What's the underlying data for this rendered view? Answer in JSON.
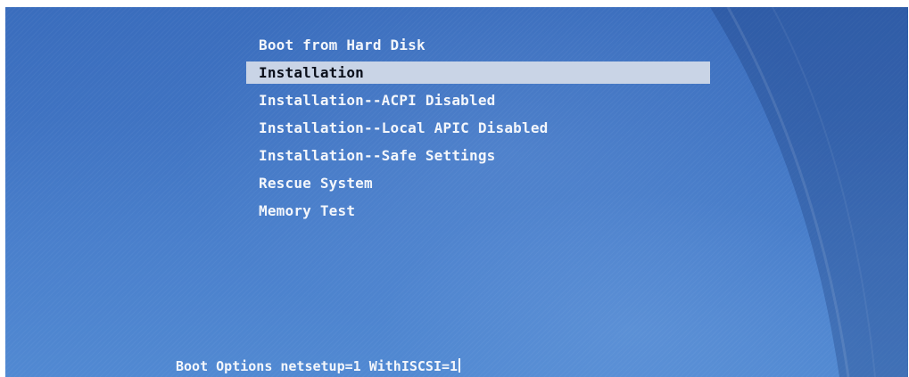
{
  "menu": {
    "items": [
      {
        "label": "Boot from Hard Disk",
        "selected": false
      },
      {
        "label": "Installation",
        "selected": true
      },
      {
        "label": "Installation--ACPI Disabled",
        "selected": false
      },
      {
        "label": "Installation--Local APIC Disabled",
        "selected": false
      },
      {
        "label": "Installation--Safe Settings",
        "selected": false
      },
      {
        "label": "Rescue System",
        "selected": false
      },
      {
        "label": "Memory Test",
        "selected": false
      }
    ]
  },
  "boot_options": {
    "label": "Boot Options",
    "value": "netsetup=1 WithISCSI=1"
  },
  "colors": {
    "background": "#4277c4",
    "text": "#f3f6fb",
    "highlight_bg": "#c9d4e6",
    "highlight_text": "#0a0f1a"
  }
}
